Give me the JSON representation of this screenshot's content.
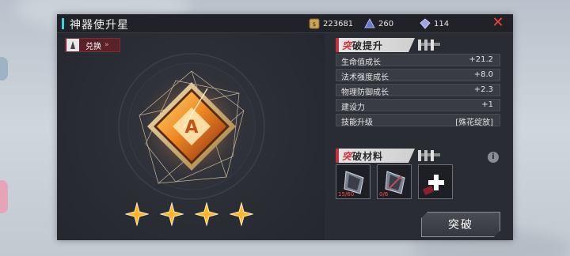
{
  "window": {
    "title": "神器使升星"
  },
  "resources": [
    {
      "icon": "gold-coin-icon",
      "value": "223681"
    },
    {
      "icon": "blue-crystal-icon",
      "value": "260"
    },
    {
      "icon": "diamond-icon",
      "value": "114"
    }
  ],
  "exchange": {
    "label": "兑换"
  },
  "emblem": {
    "letter": "A"
  },
  "stars": {
    "filled": 4
  },
  "breakthrough": {
    "title_prefix": "突",
    "title_rest": "破提升",
    "stats": [
      {
        "name": "生命值成长",
        "value": "+21.2"
      },
      {
        "name": "法术强度成长",
        "value": "+8.0"
      },
      {
        "name": "物理防御成长",
        "value": "+2.3"
      },
      {
        "name": "建设力",
        "value": "+1"
      },
      {
        "name": "技能升级",
        "value": "[殊花绽放]"
      }
    ]
  },
  "materials": {
    "title_prefix": "突",
    "title_rest": "破材料",
    "items": [
      {
        "icon": "crystal-shard-icon",
        "count": "15/60"
      },
      {
        "icon": "crystal-shard-icon",
        "count": "0/6"
      },
      {
        "icon": "add-material-icon",
        "count": ""
      }
    ]
  },
  "action": {
    "label": "突破"
  },
  "colors": {
    "accent_cyan": "#3fd2d8",
    "close_red": "#ff3b3b",
    "star_gold": "#ffb52e"
  }
}
